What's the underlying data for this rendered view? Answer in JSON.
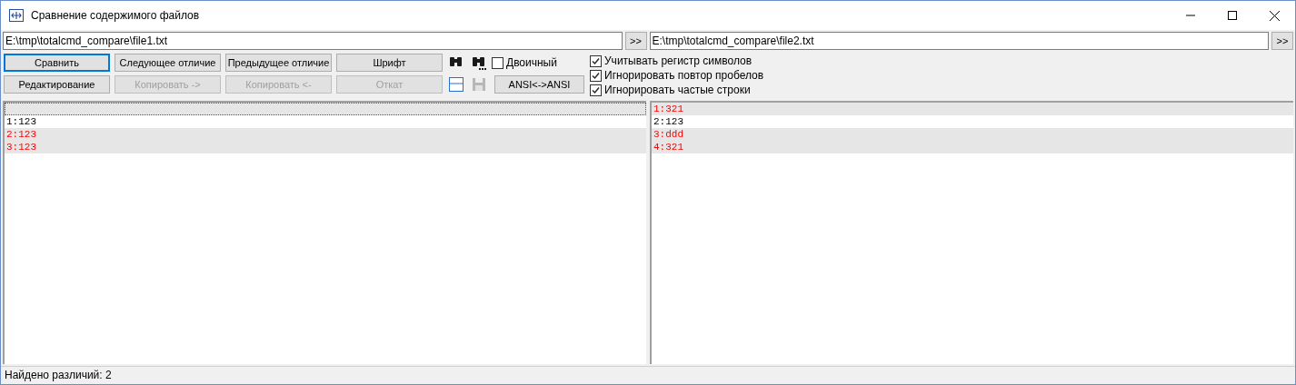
{
  "window": {
    "title": "Сравнение содержимого файлов"
  },
  "left_path": {
    "value": "E:\\tmp\\totalcmd_compare\\file1.txt",
    "browse": ">>"
  },
  "right_path": {
    "value": "E:\\tmp\\totalcmd_compare\\file2.txt",
    "browse": ">>"
  },
  "toolbar_rows": [
    [
      {
        "label": "Сравнить",
        "disabled": false,
        "focused": true
      },
      {
        "label": "Следующее отличие",
        "disabled": false,
        "focused": false
      },
      {
        "label": "Предыдущее отличие",
        "disabled": false,
        "focused": false
      },
      {
        "label": "Шрифт",
        "disabled": false,
        "focused": false
      }
    ],
    [
      {
        "label": "Редактирование",
        "disabled": false,
        "focused": false
      },
      {
        "label": "Копировать ->",
        "disabled": true,
        "focused": false
      },
      {
        "label": "Копировать <-",
        "disabled": true,
        "focused": false
      },
      {
        "label": "Откат",
        "disabled": true,
        "focused": false
      }
    ]
  ],
  "icon_buttons": [
    {
      "kind": "find",
      "disabled": false
    },
    {
      "kind": "find_next",
      "disabled": false
    },
    {
      "kind": "window",
      "disabled": false
    },
    {
      "kind": "save",
      "disabled": true
    }
  ],
  "binary": {
    "label": "Двоичный",
    "checked": false
  },
  "encoding_button": {
    "label": "ANSI<->ANSI"
  },
  "options": [
    {
      "label": "Учитывать регистр символов",
      "checked": true
    },
    {
      "label": "Игнорировать повтор пробелов",
      "checked": true
    },
    {
      "label": "Игнорировать частые строки",
      "checked": true
    }
  ],
  "left_lines": [
    {
      "kind": "blank",
      "diff": true
    },
    {
      "text": "1:123",
      "diff": false
    },
    {
      "text": "2:123",
      "diff": true
    },
    {
      "text": "3:123",
      "diff": true
    }
  ],
  "right_lines": [
    {
      "text": "1:321",
      "diff": true
    },
    {
      "text": "2:123",
      "diff": false
    },
    {
      "text": "3:ddd",
      "diff": true
    },
    {
      "text": "4:321",
      "diff": true
    }
  ],
  "status_bar": "Найдено различий: 2"
}
